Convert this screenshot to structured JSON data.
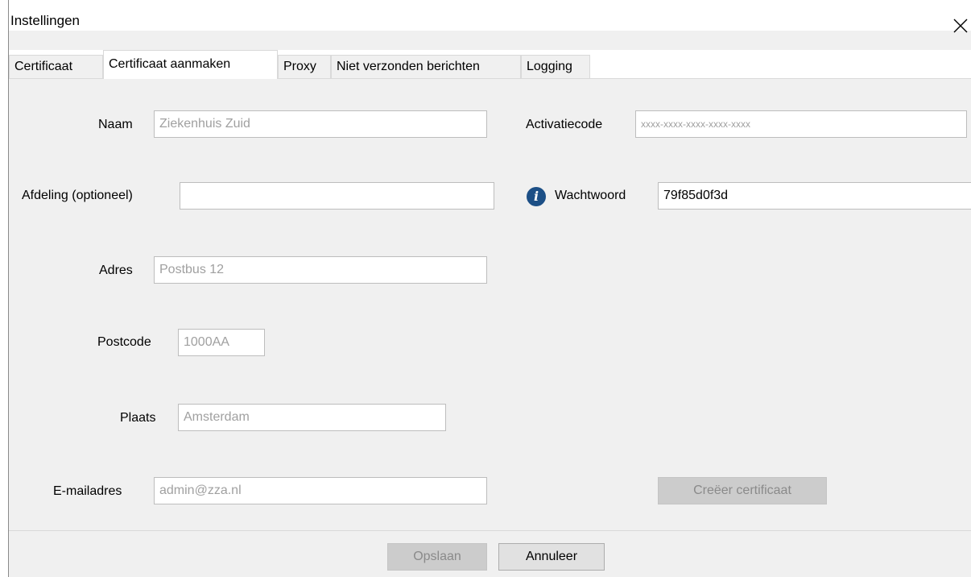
{
  "window": {
    "title": "Instellingen"
  },
  "tabs": [
    {
      "label": "Certificaat",
      "active": false
    },
    {
      "label": "Certificaat aanmaken",
      "active": true
    },
    {
      "label": "Proxy",
      "active": false
    },
    {
      "label": "Niet verzonden berichten",
      "active": false
    },
    {
      "label": "Logging",
      "active": false
    }
  ],
  "form": {
    "naam": {
      "label": "Naam",
      "placeholder": "Ziekenhuis Zuid",
      "value": ""
    },
    "afdeling": {
      "label": "Afdeling (optioneel)",
      "placeholder": "",
      "value": ""
    },
    "adres": {
      "label": "Adres",
      "placeholder": "Postbus 12",
      "value": ""
    },
    "postcode": {
      "label": "Postcode",
      "placeholder": "1000AA",
      "value": ""
    },
    "plaats": {
      "label": "Plaats",
      "placeholder": "Amsterdam",
      "value": ""
    },
    "email": {
      "label": "E-mailadres",
      "placeholder": "admin@zza.nl",
      "value": ""
    },
    "activatiecode": {
      "label": "Activatiecode",
      "placeholder": "xxxx-xxxx-xxxx-xxxx-xxxx",
      "value": ""
    },
    "wachtwoord": {
      "label": "Wachtwoord",
      "value": "79f85d0f3d",
      "icon": "info-icon"
    }
  },
  "buttons": {
    "create_certificate": "Creëer certificaat",
    "save": "Opslaan",
    "cancel": "Annuleer"
  },
  "colors": {
    "info_icon": "#1c4f86",
    "disabled_button": "#cccccc"
  }
}
